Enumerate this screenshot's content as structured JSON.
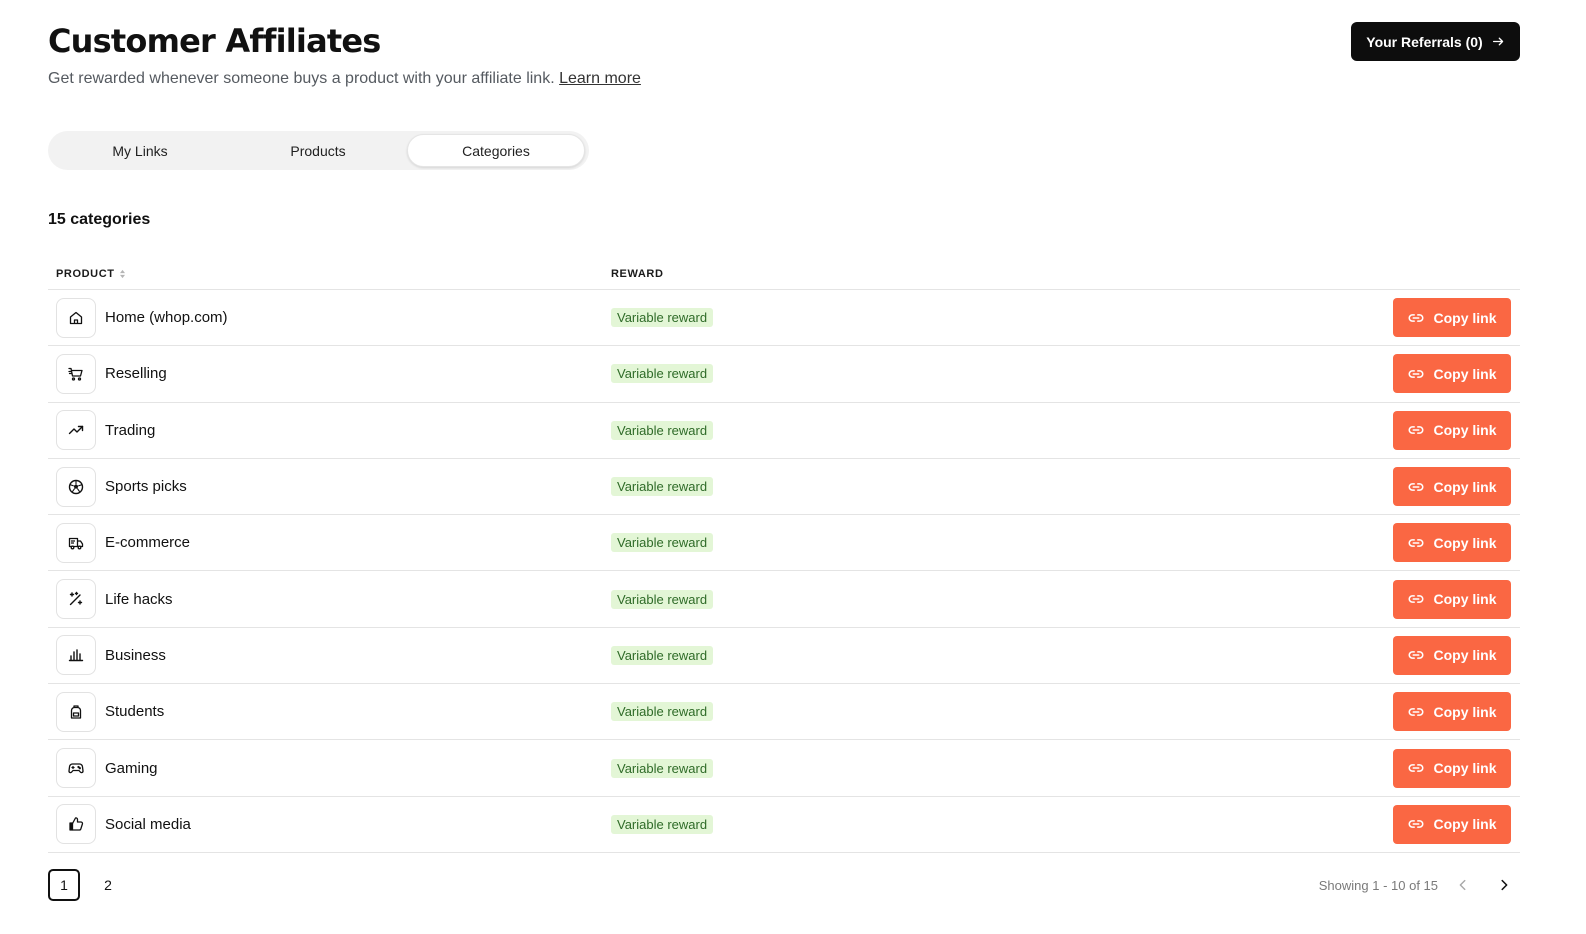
{
  "header": {
    "title": "Customer Affiliates",
    "subtitle": "Get rewarded whenever someone buys a product with your affiliate link.",
    "learn_more": "Learn more",
    "referrals_button": "Your Referrals (0)"
  },
  "tabs": [
    {
      "label": "My Links",
      "active": false
    },
    {
      "label": "Products",
      "active": false
    },
    {
      "label": "Categories",
      "active": true
    }
  ],
  "count_label": "15 categories",
  "table": {
    "columns": {
      "product": "PRODUCT",
      "reward": "REWARD"
    },
    "rows": [
      {
        "name": "Home (whop.com)",
        "icon": "home-icon",
        "reward": "Variable reward",
        "action": "Copy link"
      },
      {
        "name": "Reselling",
        "icon": "cart-icon",
        "reward": "Variable reward",
        "action": "Copy link"
      },
      {
        "name": "Trading",
        "icon": "trending-up-icon",
        "reward": "Variable reward",
        "action": "Copy link"
      },
      {
        "name": "Sports picks",
        "icon": "soccer-ball-icon",
        "reward": "Variable reward",
        "action": "Copy link"
      },
      {
        "name": "E-commerce",
        "icon": "delivery-truck-icon",
        "reward": "Variable reward",
        "action": "Copy link"
      },
      {
        "name": "Life hacks",
        "icon": "magic-wand-icon",
        "reward": "Variable reward",
        "action": "Copy link"
      },
      {
        "name": "Business",
        "icon": "bar-chart-icon",
        "reward": "Variable reward",
        "action": "Copy link"
      },
      {
        "name": "Students",
        "icon": "backpack-icon",
        "reward": "Variable reward",
        "action": "Copy link"
      },
      {
        "name": "Gaming",
        "icon": "gamepad-icon",
        "reward": "Variable reward",
        "action": "Copy link"
      },
      {
        "name": "Social media",
        "icon": "thumbs-up-icon",
        "reward": "Variable reward",
        "action": "Copy link"
      }
    ]
  },
  "pagination": {
    "pages": [
      "1",
      "2"
    ],
    "current": "1",
    "showing": "Showing 1 - 10 of 15"
  },
  "colors": {
    "accent": "#fa6743",
    "badge_bg": "#e3f6d6",
    "badge_text": "#2f6b28",
    "dark_button": "#0d0d0d"
  }
}
